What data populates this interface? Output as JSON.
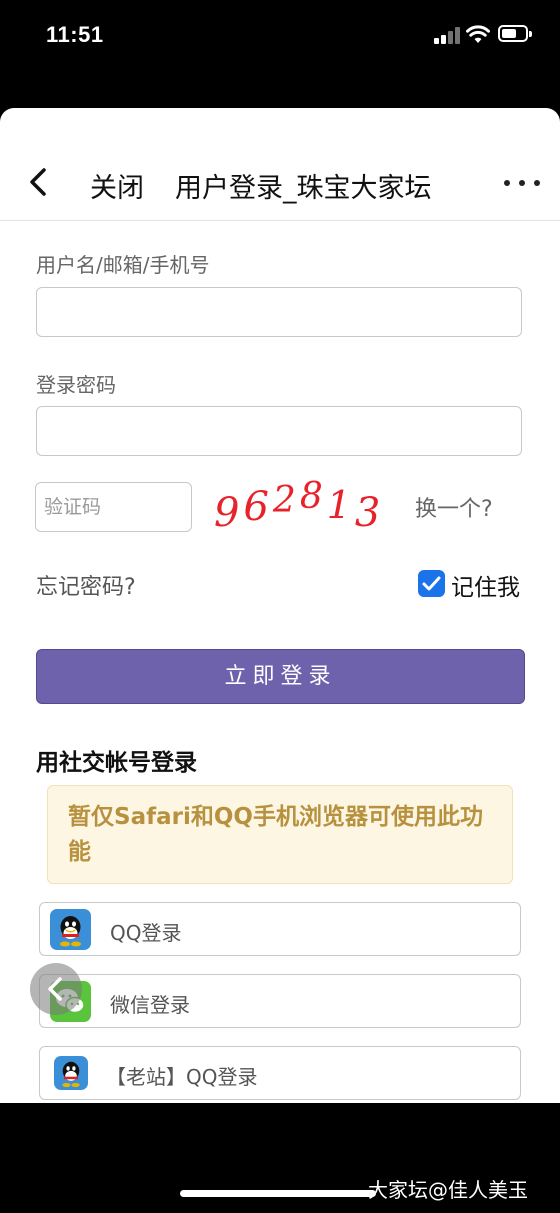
{
  "status_bar": {
    "time": "11:51"
  },
  "nav": {
    "close_label": "关闭",
    "title": "用户登录_珠宝大家坛"
  },
  "form": {
    "username_label": "用户名/邮箱/手机号",
    "password_label": "登录密码",
    "captcha_placeholder": "验证码",
    "captcha_code": "962813",
    "refresh_label": "换一个?",
    "forgot_label": "忘记密码?",
    "remember_label": "记住我",
    "remember_checked": true,
    "login_button": "立即登录"
  },
  "social": {
    "heading": "用社交帐号登录",
    "notice": "暂仅Safari和QQ手机浏览器可使用此功能",
    "buttons": [
      {
        "label": "QQ登录",
        "icon": "qq-icon"
      },
      {
        "label": "微信登录",
        "icon": "wechat-icon"
      },
      {
        "label": "【老站】QQ登录",
        "icon": "qq-icon"
      }
    ]
  },
  "watermark": "大家坛@佳人美玉",
  "colors": {
    "primary_button": "#6f62ac",
    "notice_bg": "#fdf6e3",
    "notice_text": "#b8913f",
    "checkbox": "#1a73e8"
  }
}
